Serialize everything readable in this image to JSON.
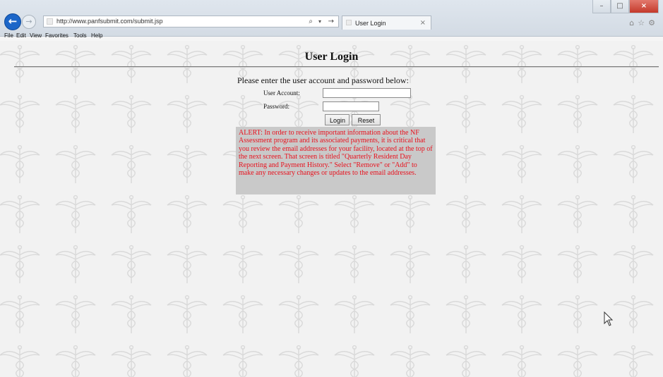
{
  "browser": {
    "url": "http://www.panfsubmit.com/submit.jsp",
    "tab_title": "User Login",
    "menu": [
      "File",
      "Edit",
      "View",
      "Favorites",
      "Tools",
      "Help"
    ]
  },
  "page": {
    "title": "User Login",
    "prompt": "Please enter the user account and password below:",
    "account_label": "User Account:",
    "password_label": "Password:",
    "account_value": "",
    "password_value": "",
    "login_label": "Login",
    "reset_label": "Reset",
    "alert_text": "ALERT: In order to receive important information about the NF Assessment program and its associated payments, it is critical that you review the email addresses for your facility, located at the top of the next screen. That screen is titled \"Quarterly Resident Day Reporting and Payment History.\" Select \"Remove\" or \"Add\" to make any necessary changes or updates to the email addresses."
  },
  "colors": {
    "alert_text": "#e8111d",
    "alert_bg": "#c9c9c9",
    "back_button": "#1c66c8"
  },
  "icons": [
    "back-arrow-icon",
    "forward-arrow-icon",
    "search-icon",
    "refresh-icon",
    "close-icon",
    "home-icon",
    "star-icon",
    "gear-icon",
    "caduceus-watermark-icon",
    "mouse-cursor-icon"
  ]
}
